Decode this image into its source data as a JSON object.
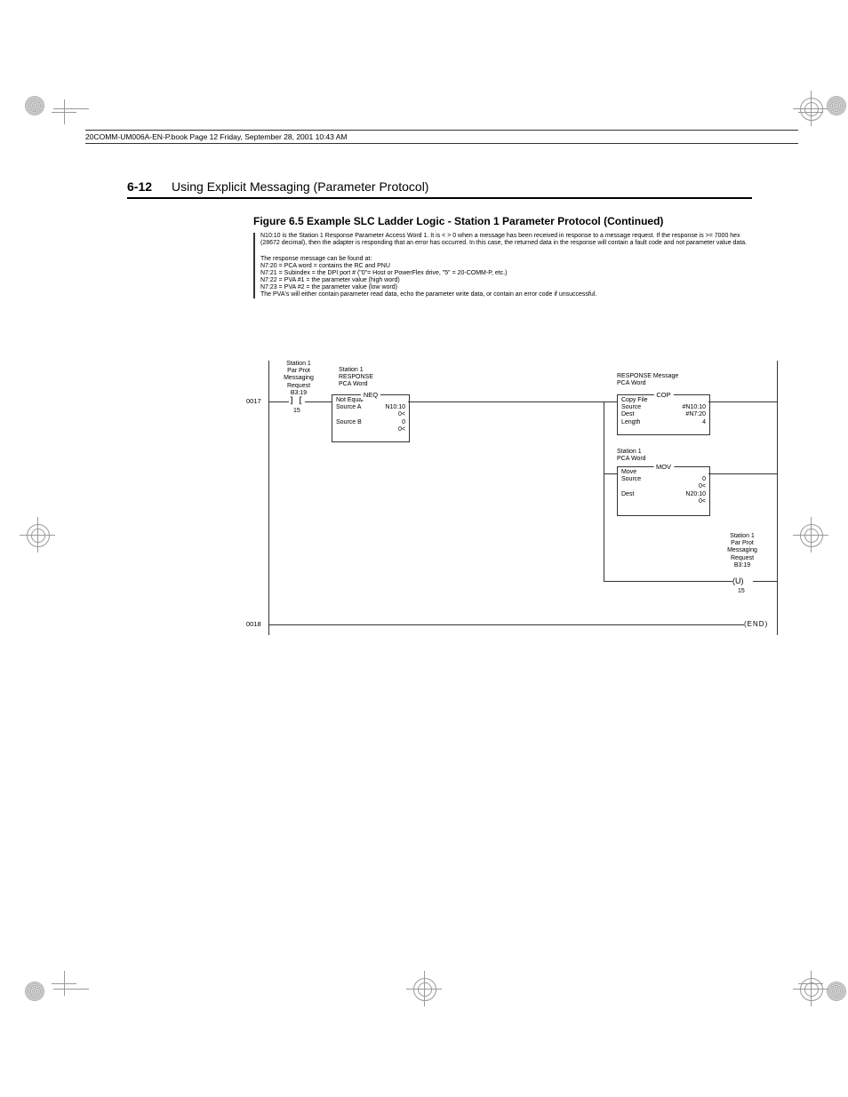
{
  "header_bookinfo": "20COMM-UM006A-EN-P.book  Page 12  Friday, September 28, 2001  10:43 AM",
  "page_number": "6-12",
  "page_title": "Using Explicit Messaging (Parameter Protocol)",
  "figure_caption": "Figure 6.5   Example SLC Ladder Logic - Station 1 Parameter Protocol (Continued)",
  "description_paragraph_1": "N10:10 is the Station 1 Response Parameter Access Word 1.  It is < > 0 when a message has been received in response to a message request.  If the response is >= 7000 hex (28672 decimal), then the adapter is responding that an error has occurred.  In this case, the returned data in the response will contain a fault code and not parameter value data.",
  "description_paragraph_2_l1": "The response message can be found at:",
  "description_paragraph_2_l2": "N7:20 = PCA word = contains the RC and PNU",
  "description_paragraph_2_l3": "N7:21 = Subindex = the DPI port # (\"0\"= Host or PowerFlex drive, \"5\" = 20-COMM-P, etc.)",
  "description_paragraph_2_l4": "N7:22 = PVA #1 = the parameter value (high word)",
  "description_paragraph_2_l5": "N7:23 = PVA #2 = the parameter value (low word)",
  "description_paragraph_2_l6": "The PVA's will either contain parameter read data, echo the parameter write data, or contain an error code if unsuccessful.",
  "rung0017_num": "0017",
  "rung0018_num": "0018",
  "contact_label": {
    "l1": "Station 1",
    "l2": "Par Prot",
    "l3": "Messaging",
    "l4": "Request",
    "l5": "B3:19",
    "bit": "15"
  },
  "neq_block": {
    "label1": "Station 1",
    "label2": "RESPONSE",
    "label3": "PCA Word",
    "title": "NEQ",
    "line1": "Not Equal",
    "row1_l": "Source A",
    "row1_r": "N10:10",
    "row1b_r": "0<",
    "row2_l": "Source B",
    "row2_r": "0",
    "row2b_r": "0<"
  },
  "cop_block": {
    "label1": "RESPONSE Message",
    "label2": "PCA Word",
    "title": "COP",
    "line1": "Copy File",
    "row1_l": "Source",
    "row1_r": "#N10:10",
    "row2_l": "Dest",
    "row2_r": "#N7:20",
    "row3_l": "Length",
    "row3_r": "4"
  },
  "mov_block": {
    "label1": "Station 1",
    "label2": "PCA Word",
    "title": "MOV",
    "line1": "Move",
    "row1_l": "Source",
    "row1_r": "0",
    "row1b_r": "0<",
    "row2_l": "Dest",
    "row2_r": "N20:10",
    "row2b_r": "0<"
  },
  "coil_label": {
    "l1": "Station 1",
    "l2": "Par Prot",
    "l3": "Messaging",
    "l4": "Request",
    "l5": "B3:19",
    "bit": "15",
    "symbol": "U"
  },
  "end_symbol": "END"
}
